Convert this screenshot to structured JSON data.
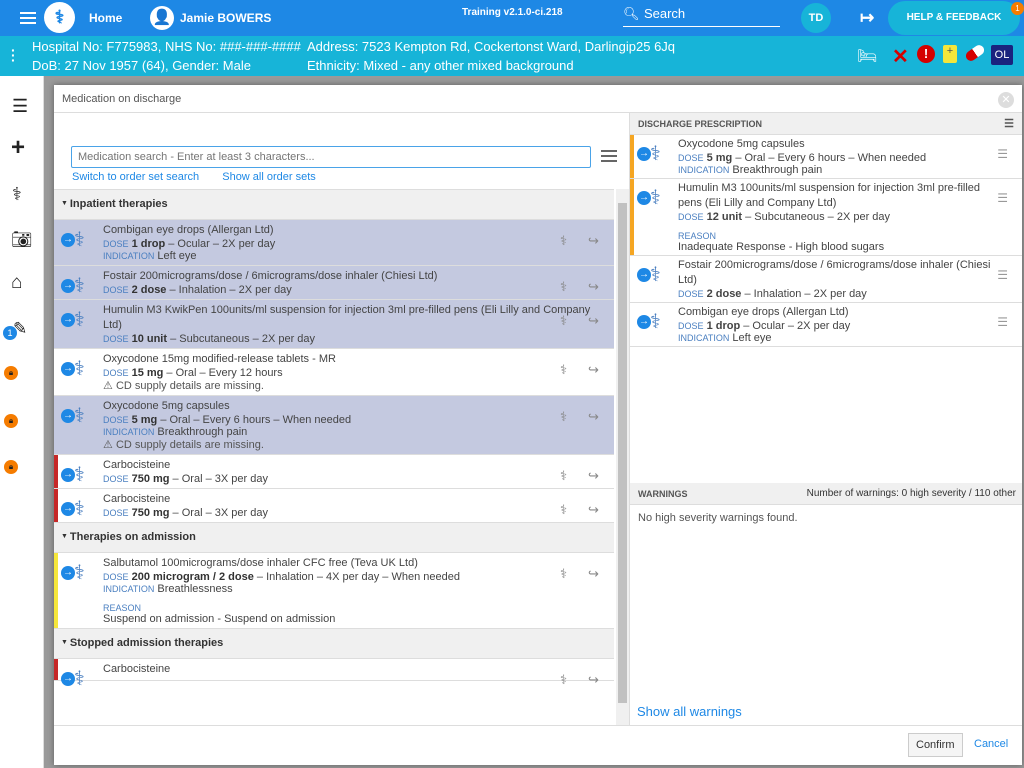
{
  "topbar": {
    "home": "Home",
    "patient_name": "Jamie BOWERS",
    "training": "Training v2.1.0-ci.218",
    "search": "Search",
    "avatar": "TD",
    "help": "HELP & FEEDBACK",
    "help_badge": "1"
  },
  "patient": {
    "line1_left": "Hospital No: F775983, NHS No: ###-###-####",
    "line1_right": "Address: 7523 Kempton Rd, Cockertonst Ward, Darlingip25 6Jq",
    "line2_left": "DoB: 27 Nov 1957 (64), Gender: Male",
    "line2_right": "Ethnicity: Mixed - any other mixed background",
    "ol_label": "OL"
  },
  "sidebar": {
    "badge": "1"
  },
  "dialog": {
    "title": "Medication on discharge",
    "search_placeholder": "Medication search - Enter at least 3 characters...",
    "link_orderset": "Switch to order set search",
    "link_showall": "Show all order sets",
    "dose_label": "DOSE",
    "indication_label": "INDICATION",
    "reason_label": "REASON",
    "cd_warning": "CD supply details are missing.",
    "sections": [
      {
        "title": "Inpatient therapies",
        "items": [
          {
            "name": "Combigan eye drops (Allergan Ltd)",
            "dose": "1 drop",
            "rest": " – Ocular – 2X per day",
            "indication": "Left eye",
            "selected": true
          },
          {
            "name": "Fostair 200micrograms/dose / 6micrograms/dose inhaler (Chiesi Ltd)",
            "dose": "2 dose",
            "rest": " – Inhalation – 2X per day",
            "selected": true
          },
          {
            "name": "Humulin M3 KwikPen 100units/ml suspension for injection 3ml pre-filled pens (Eli Lilly and Company Ltd)",
            "dose": "10 unit",
            "rest": " – Subcutaneous – 2X per day",
            "selected": true
          },
          {
            "name": "Oxycodone 15mg modified-release tablets - MR",
            "dose": "15 mg",
            "rest": " – Oral – Every 12 hours",
            "cd": true,
            "selected": false
          },
          {
            "name": "Oxycodone 5mg capsules",
            "dose": "5 mg",
            "rest": " – Oral – Every 6 hours – When needed",
            "indication": "Breakthrough pain",
            "cd": true,
            "selected": true
          },
          {
            "name": "Carbocisteine",
            "dose": "750 mg",
            "rest": " – Oral – 3X per day",
            "bar": "#c62828",
            "selected": false
          },
          {
            "name": "Carbocisteine",
            "dose": "750 mg",
            "rest": " – Oral – 3X per day",
            "bar": "#c62828",
            "selected": false
          }
        ]
      },
      {
        "title": "Therapies on admission",
        "items": [
          {
            "name": "Salbutamol 100micrograms/dose inhaler CFC free (Teva UK Ltd)",
            "dose": "200 microgram / 2 dose",
            "rest": " – Inhalation – 4X per day – When needed",
            "indication": "Breathlessness",
            "reason": "Suspend on admission - Suspend on admission",
            "bar": "#f5e63b",
            "selected": false
          }
        ]
      },
      {
        "title": "Stopped admission therapies",
        "items": [
          {
            "name": "Carbocisteine",
            "dose": "",
            "rest": "",
            "bar": "#c62828",
            "selected": false
          }
        ]
      }
    ],
    "discharge": {
      "title": "DISCHARGE PRESCRIPTION",
      "items": [
        {
          "name": "Oxycodone 5mg capsules",
          "dose": "5 mg",
          "rest": " – Oral – Every 6 hours – When needed",
          "indication": "Breakthrough pain",
          "bar": "#f5a623"
        },
        {
          "name": "Humulin M3 100units/ml suspension for injection 3ml pre-filled pens (Eli Lilly and Company Ltd)",
          "dose": "12 unit",
          "rest": " – Subcutaneous – 2X per day",
          "reason": "Inadequate Response - High blood sugars",
          "bar": "#f5a623"
        },
        {
          "name": "Fostair 200micrograms/dose / 6micrograms/dose inhaler (Chiesi Ltd)",
          "dose": "2 dose",
          "rest": " – Inhalation – 2X per day"
        },
        {
          "name": "Combigan eye drops (Allergan Ltd)",
          "dose": "1 drop",
          "rest": " – Ocular – 2X per day",
          "indication": "Left eye"
        }
      ]
    },
    "warnings": {
      "title": "WARNINGS",
      "count": "Number of warnings: 0 high severity / 110 other",
      "message": "No high severity warnings found.",
      "show_all": "Show all warnings"
    },
    "confirm": "Confirm",
    "cancel": "Cancel"
  },
  "colors": {
    "topbar": "#1e88e5",
    "patient_bar": "#17b4d8",
    "selected_row": "#c4c9e0"
  }
}
